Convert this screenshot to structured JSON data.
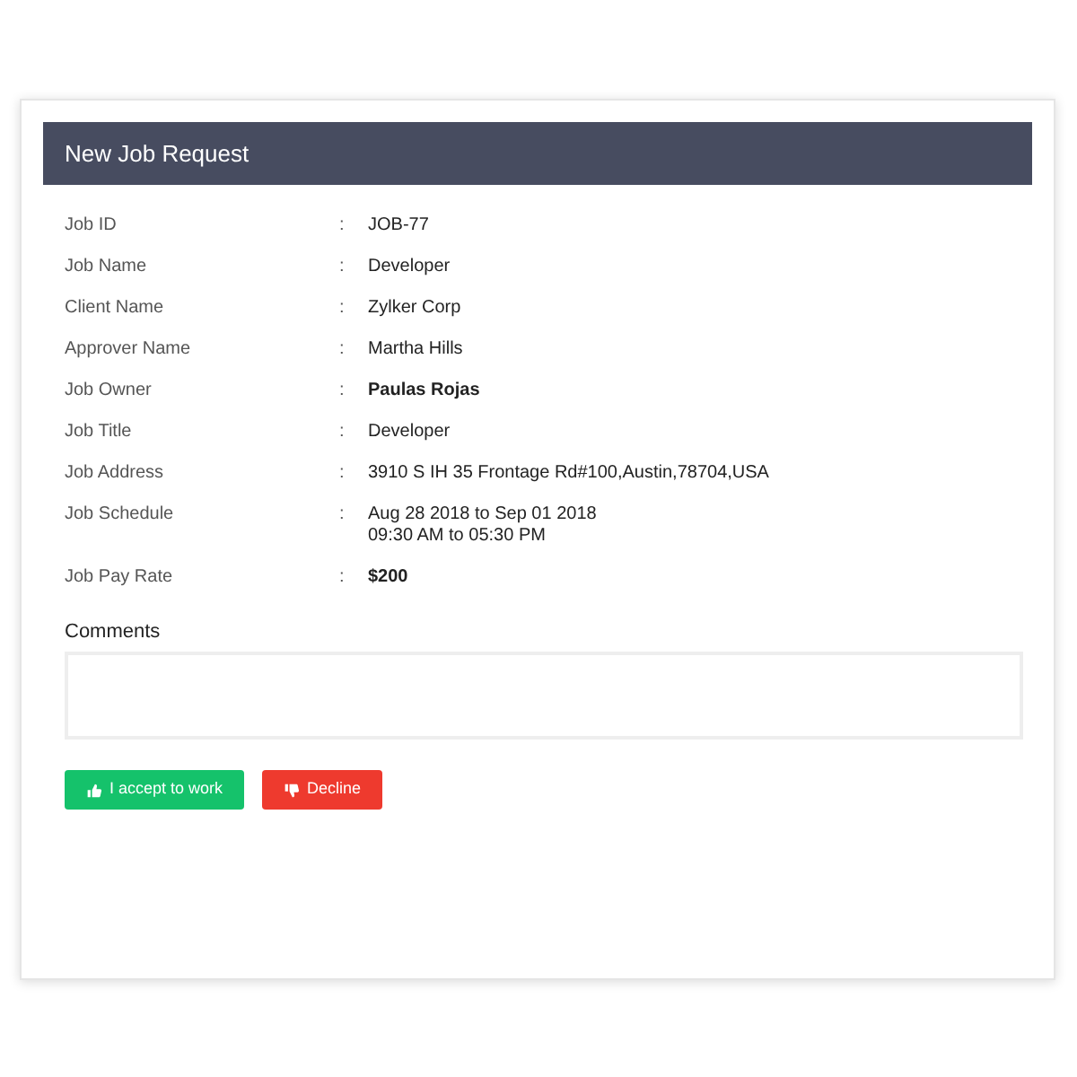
{
  "header": {
    "title": "New Job Request"
  },
  "fields": [
    {
      "label": "Job ID",
      "separator": ":",
      "value": [
        "JOB-77"
      ],
      "bold": false
    },
    {
      "label": "Job Name",
      "separator": ":",
      "value": [
        "Developer"
      ],
      "bold": false
    },
    {
      "label": "Client Name",
      "separator": ":",
      "value": [
        "Zylker Corp"
      ],
      "bold": false
    },
    {
      "label": "Approver Name",
      "separator": ":",
      "value": [
        "Martha Hills"
      ],
      "bold": false
    },
    {
      "label": "Job Owner",
      "separator": ":",
      "value": [
        "Paulas Rojas"
      ],
      "bold": true
    },
    {
      "label": "Job Title",
      "separator": ":",
      "value": [
        "Developer"
      ],
      "bold": false
    },
    {
      "label": "Job Address",
      "separator": ":",
      "value": [
        "3910 S IH 35 Frontage Rd#100,Austin,78704,USA"
      ],
      "bold": false
    },
    {
      "label": "Job Schedule",
      "separator": ":",
      "value": [
        "Aug 28 2018 to Sep 01 2018",
        "09:30 AM to 05:30 PM"
      ],
      "bold": false
    },
    {
      "label": "Job Pay Rate",
      "separator": ":",
      "value": [
        "$200"
      ],
      "bold": true
    }
  ],
  "comments": {
    "label": "Comments"
  },
  "buttons": [
    {
      "kind": "accept",
      "label": "I accept to work"
    },
    {
      "kind": "decline",
      "label": "Decline"
    }
  ]
}
